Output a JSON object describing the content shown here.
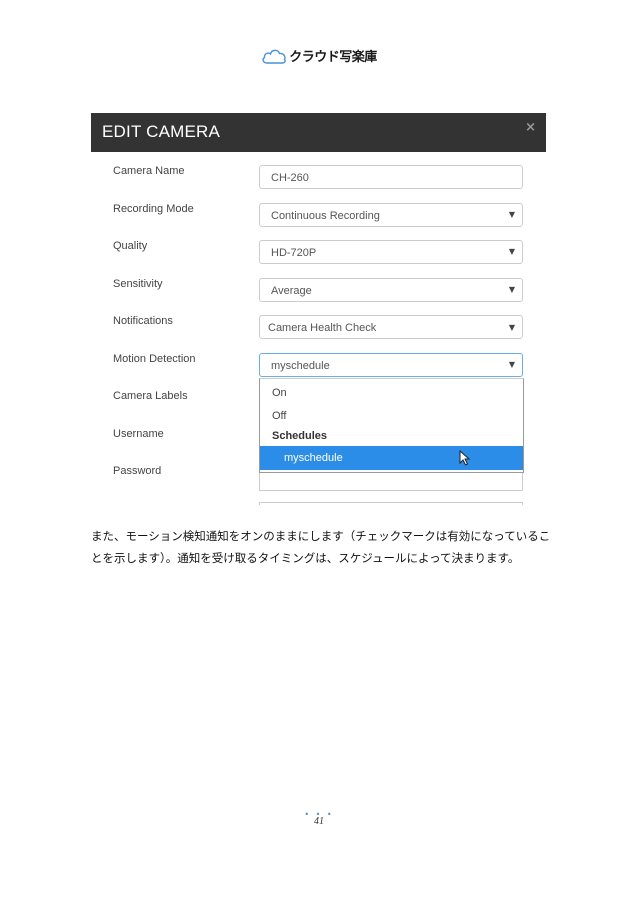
{
  "header": {
    "logo_text": "クラウド写楽庫",
    "cloud_color": "#4a90d9"
  },
  "dialog": {
    "title": "EDIT CAMERA",
    "close_label": "×",
    "fields": [
      {
        "label": "Camera Name",
        "value": "CH-260",
        "type": "text"
      },
      {
        "label": "Recording Mode",
        "value": "Continuous Recording",
        "type": "select"
      },
      {
        "label": "Quality",
        "value": "HD-720P",
        "type": "select"
      },
      {
        "label": "Sensitivity",
        "value": "Average",
        "type": "select"
      },
      {
        "label": "Notifications",
        "value": "Camera Health Check",
        "type": "select"
      },
      {
        "label": "Motion Detection",
        "value": "myschedule",
        "type": "select"
      },
      {
        "label": "Camera Labels"
      },
      {
        "label": "Username"
      },
      {
        "label": "Password"
      }
    ],
    "dropdown": {
      "options": [
        "On",
        "Off"
      ],
      "group_label": "Schedules",
      "selected_option": "myschedule"
    }
  },
  "description": {
    "line1": "また、モーション検知通知をオンのままにします（チェックマークは有効になっているこ",
    "line2": "とを示します）。通知を受け取るタイミングは、スケジュールによって決まります。"
  },
  "footer": {
    "dots": "• • •",
    "page_number": "41"
  },
  "colors": {
    "header_bg": "#333333",
    "selected_bg": "#2b8de8",
    "focus_border": "#66afe9"
  }
}
